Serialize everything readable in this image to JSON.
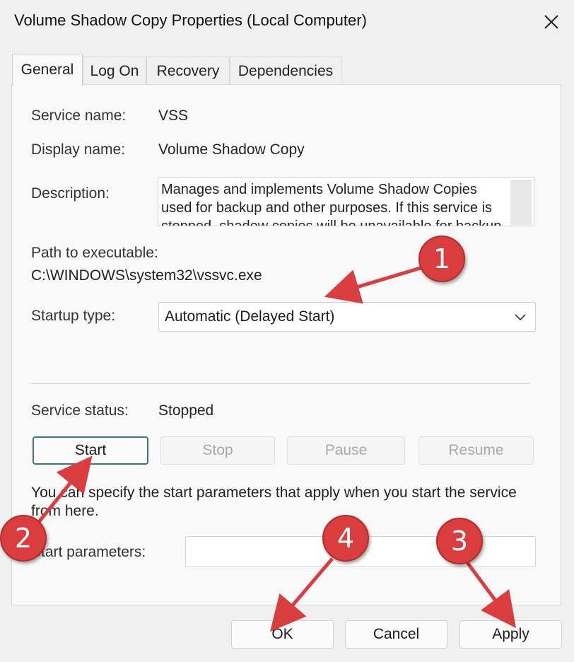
{
  "window": {
    "title": "Volume Shadow Copy Properties (Local Computer)"
  },
  "tabs": [
    {
      "label": "General",
      "active": true
    },
    {
      "label": "Log On",
      "active": false
    },
    {
      "label": "Recovery",
      "active": false
    },
    {
      "label": "Dependencies",
      "active": false
    }
  ],
  "general": {
    "service_name_label": "Service name:",
    "service_name": "VSS",
    "display_name_label": "Display name:",
    "display_name": "Volume Shadow Copy",
    "description_label": "Description:",
    "description": "Manages and implements Volume Shadow Copies used for backup and other purposes. If this service is stopped, shadow copies will be unavailable for backup and the backup may fail.",
    "path_label": "Path to executable:",
    "path": "C:\\WINDOWS\\system32\\vssvc.exe",
    "startup_label": "Startup type:",
    "startup_value": "Automatic (Delayed Start)",
    "status_label": "Service status:",
    "status_value": "Stopped",
    "buttons": {
      "start": "Start",
      "stop": "Stop",
      "pause": "Pause",
      "resume": "Resume"
    },
    "info_text": "You can specify the start parameters that apply when you start the service from here.",
    "params_label": "Start parameters:",
    "params_value": ""
  },
  "footer": {
    "ok": "OK",
    "cancel": "Cancel",
    "apply": "Apply"
  },
  "annotations": [
    {
      "number": "1"
    },
    {
      "number": "2"
    },
    {
      "number": "3"
    },
    {
      "number": "4"
    }
  ],
  "colors": {
    "annotation": "#d93d3d",
    "focus_border": "#3a7a7a"
  }
}
